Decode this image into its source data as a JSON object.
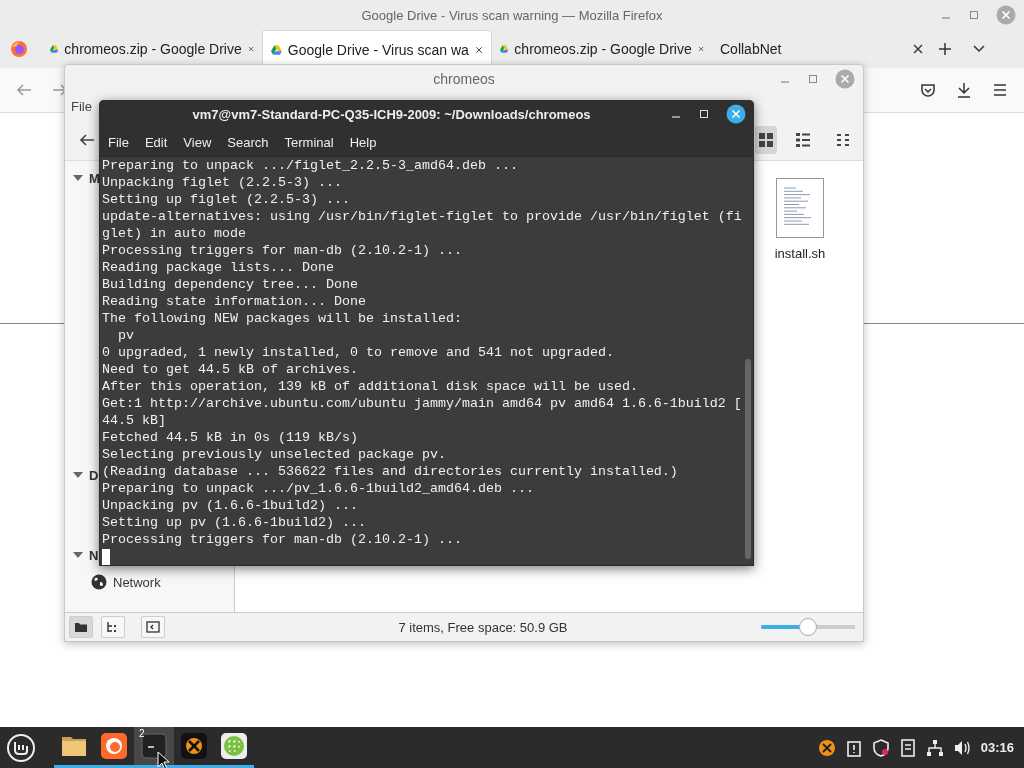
{
  "firefox": {
    "title": "Google Drive - Virus scan warning — Mozilla Firefox",
    "tabs": [
      {
        "label": "chromeos.zip - Google Drive",
        "kind": "drive",
        "selected": false
      },
      {
        "label": "Google Drive - Virus scan wa",
        "kind": "drive",
        "selected": true
      },
      {
        "label": "chromeos.zip - Google Drive",
        "kind": "drive",
        "selected": false
      },
      {
        "label": "CollabNet",
        "kind": "plain",
        "selected": false
      }
    ]
  },
  "file_manager": {
    "title": "chromeos",
    "menu": [
      "File"
    ],
    "sidebar": [
      {
        "heading": "M"
      },
      {
        "heading": "D"
      },
      {
        "heading": "N",
        "items": [
          {
            "label": "Network"
          }
        ]
      }
    ],
    "view_buttons": [
      {
        "kind": "icons",
        "selected": true
      },
      {
        "kind": "list",
        "selected": false
      },
      {
        "kind": "compact",
        "selected": false
      }
    ],
    "files": [
      {
        "name": "install.sh"
      }
    ],
    "status": "7 items, Free space: 50.9 GB",
    "zoom": {
      "level": 0.5
    }
  },
  "terminal": {
    "title": "vm7@vm7-Standard-PC-Q35-ICH9-2009: ~/Downloads/chromeos",
    "menu": [
      "File",
      "Edit",
      "View",
      "Search",
      "Terminal",
      "Help"
    ],
    "lines": [
      "Preparing to unpack .../figlet_2.2.5-3_amd64.deb ...",
      "Unpacking figlet (2.2.5-3) ...",
      "Setting up figlet (2.2.5-3) ...",
      "update-alternatives: using /usr/bin/figlet-figlet to provide /usr/bin/figlet (fi",
      "glet) in auto mode",
      "Processing triggers for man-db (2.10.2-1) ...",
      "Reading package lists... Done",
      "Building dependency tree... Done",
      "Reading state information... Done",
      "The following NEW packages will be installed:",
      "  pv",
      "0 upgraded, 1 newly installed, 0 to remove and 541 not upgraded.",
      "Need to get 44.5 kB of archives.",
      "After this operation, 139 kB of additional disk space will be used.",
      "Get:1 http://archive.ubuntu.com/ubuntu jammy/main amd64 pv amd64 1.6.6-1build2 [",
      "44.5 kB]",
      "Fetched 44.5 kB in 0s (119 kB/s)",
      "Selecting previously unselected package pv.",
      "(Reading database ... 536622 files and directories currently installed.)",
      "Preparing to unpack .../pv_1.6.6-1build2_amd64.deb ...",
      "Unpacking pv (1.6.6-1build2) ...",
      "Setting up pv (1.6.6-1build2) ...",
      "Processing triggers for man-db (2.10.2-1) ..."
    ]
  },
  "taskbar": {
    "apps": [
      {
        "kind": "files",
        "active": false
      },
      {
        "kind": "firefox",
        "active": false
      },
      {
        "kind": "terminal",
        "active": true,
        "badge": "2"
      },
      {
        "kind": "xorg",
        "active": false
      },
      {
        "kind": "grid",
        "active": false
      }
    ],
    "tray": [
      {
        "kind": "xorg"
      },
      {
        "kind": "clipboard"
      },
      {
        "kind": "shield"
      },
      {
        "kind": "notes"
      },
      {
        "kind": "network"
      },
      {
        "kind": "volume"
      }
    ],
    "clock": "03:16"
  }
}
